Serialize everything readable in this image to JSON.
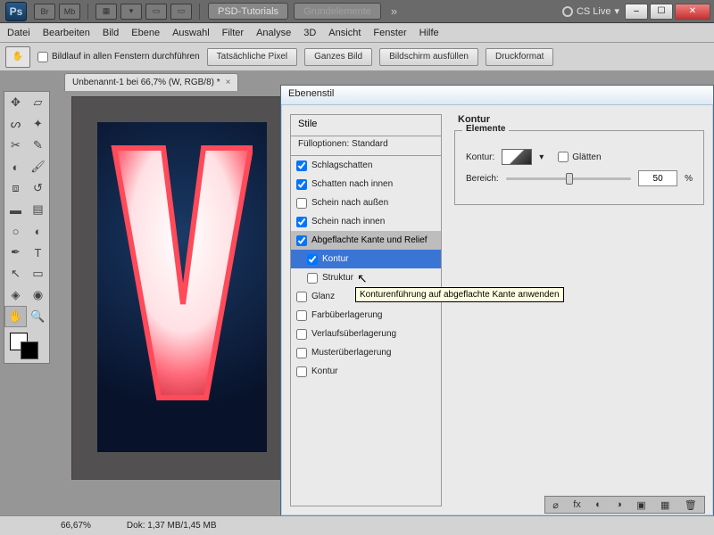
{
  "appbar": {
    "ps": "Ps",
    "br": "Br",
    "mb": "Mb",
    "pill1": "PSD-Tutorials",
    "pill2": "Grundelemente",
    "cslive": "CS Live"
  },
  "menu": [
    "Datei",
    "Bearbeiten",
    "Bild",
    "Ebene",
    "Auswahl",
    "Filter",
    "Analyse",
    "3D",
    "Ansicht",
    "Fenster",
    "Hilfe"
  ],
  "optbar": {
    "scroll_all": "Bildlauf in allen Fenstern durchführen",
    "buttons": [
      "Tatsächliche Pixel",
      "Ganzes Bild",
      "Bildschirm ausfüllen",
      "Druckformat"
    ]
  },
  "doc_tab": "Unbenannt-1 bei 66,7% (W, RGB/8) *",
  "dialog": {
    "title": "Ebenenstil",
    "styles_head": "Stile",
    "fill_opts": "Fülloptionen: Standard",
    "items": [
      {
        "label": "Schlagschatten",
        "checked": true,
        "indent": false
      },
      {
        "label": "Schatten nach innen",
        "checked": true,
        "indent": false
      },
      {
        "label": "Schein nach außen",
        "checked": false,
        "indent": false
      },
      {
        "label": "Schein nach innen",
        "checked": true,
        "indent": false
      },
      {
        "label": "Abgeflachte Kante und Relief",
        "checked": true,
        "indent": false,
        "section": true
      },
      {
        "label": "Kontur",
        "checked": true,
        "indent": true,
        "selected": true
      },
      {
        "label": "Struktur",
        "checked": false,
        "indent": true
      },
      {
        "label": "Glanz",
        "checked": false,
        "indent": false
      },
      {
        "label": "Farbüberlagerung",
        "checked": false,
        "indent": false
      },
      {
        "label": "Verlaufsüberlagerung",
        "checked": false,
        "indent": false
      },
      {
        "label": "Musterüberlagerung",
        "checked": false,
        "indent": false
      },
      {
        "label": "Kontur",
        "checked": false,
        "indent": false
      }
    ],
    "right": {
      "section": "Kontur",
      "group": "Elemente",
      "kontur_label": "Kontur:",
      "glatten": "Glätten",
      "bereich_label": "Bereich:",
      "bereich_value": "50",
      "percent": "%"
    }
  },
  "tooltip": "Konturenführung auf abgeflachte Kante anwenden",
  "status": {
    "zoom": "66,67%",
    "doc": "Dok: 1,37 MB/1,45 MB"
  }
}
